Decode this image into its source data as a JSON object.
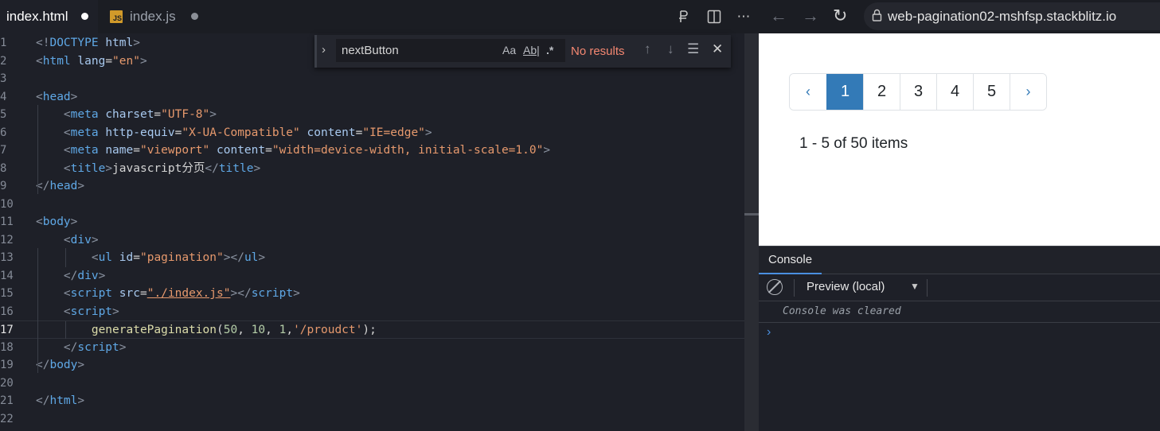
{
  "tabs": [
    {
      "label": "index.html",
      "modified": true,
      "active": true
    },
    {
      "label": "index.js",
      "icon": "JS",
      "modified": true,
      "active": false
    }
  ],
  "editor_lines": [
    {
      "n": "1",
      "tokens": [
        [
          "t-br",
          "<!"
        ],
        [
          "t-tag",
          "DOCTYPE"
        ],
        [
          "t-txt",
          " "
        ],
        [
          "t-attr",
          "html"
        ],
        [
          "t-br",
          ">"
        ]
      ]
    },
    {
      "n": "2",
      "tokens": [
        [
          "t-br",
          "<"
        ],
        [
          "t-tag",
          "html"
        ],
        [
          "t-txt",
          " "
        ],
        [
          "t-attr",
          "lang"
        ],
        [
          "t-txt",
          "="
        ],
        [
          "t-str",
          "\"en\""
        ],
        [
          "t-br",
          ">"
        ]
      ]
    },
    {
      "n": "3",
      "tokens": []
    },
    {
      "n": "4",
      "tokens": [
        [
          "t-br",
          "<"
        ],
        [
          "t-tag",
          "head"
        ],
        [
          "t-br",
          ">"
        ]
      ]
    },
    {
      "n": "5",
      "tokens": [
        [
          "t-txt",
          "    "
        ],
        [
          "t-br",
          "<"
        ],
        [
          "t-tag",
          "meta"
        ],
        [
          "t-txt",
          " "
        ],
        [
          "t-attr",
          "charset"
        ],
        [
          "t-txt",
          "="
        ],
        [
          "t-str",
          "\"UTF-8\""
        ],
        [
          "t-br",
          ">"
        ]
      ]
    },
    {
      "n": "6",
      "tokens": [
        [
          "t-txt",
          "    "
        ],
        [
          "t-br",
          "<"
        ],
        [
          "t-tag",
          "meta"
        ],
        [
          "t-txt",
          " "
        ],
        [
          "t-attr",
          "http-equiv"
        ],
        [
          "t-txt",
          "="
        ],
        [
          "t-str",
          "\"X-UA-Compatible\""
        ],
        [
          "t-txt",
          " "
        ],
        [
          "t-attr",
          "content"
        ],
        [
          "t-txt",
          "="
        ],
        [
          "t-str",
          "\"IE=edge\""
        ],
        [
          "t-br",
          ">"
        ]
      ]
    },
    {
      "n": "7",
      "tokens": [
        [
          "t-txt",
          "    "
        ],
        [
          "t-br",
          "<"
        ],
        [
          "t-tag",
          "meta"
        ],
        [
          "t-txt",
          " "
        ],
        [
          "t-attr",
          "name"
        ],
        [
          "t-txt",
          "="
        ],
        [
          "t-str",
          "\"viewport\""
        ],
        [
          "t-txt",
          " "
        ],
        [
          "t-attr",
          "content"
        ],
        [
          "t-txt",
          "="
        ],
        [
          "t-str",
          "\"width=device-width, initial-scale=1.0\""
        ],
        [
          "t-br",
          ">"
        ]
      ]
    },
    {
      "n": "8",
      "tokens": [
        [
          "t-txt",
          "    "
        ],
        [
          "t-br",
          "<"
        ],
        [
          "t-tag",
          "title"
        ],
        [
          "t-br",
          ">"
        ],
        [
          "t-txt",
          "javascript分页"
        ],
        [
          "t-br",
          "</"
        ],
        [
          "t-tag",
          "title"
        ],
        [
          "t-br",
          ">"
        ]
      ]
    },
    {
      "n": "9",
      "tokens": [
        [
          "t-br",
          "</"
        ],
        [
          "t-tag",
          "head"
        ],
        [
          "t-br",
          ">"
        ]
      ]
    },
    {
      "n": "10",
      "tokens": []
    },
    {
      "n": "11",
      "tokens": [
        [
          "t-br",
          "<"
        ],
        [
          "t-tag",
          "body"
        ],
        [
          "t-br",
          ">"
        ]
      ]
    },
    {
      "n": "12",
      "tokens": [
        [
          "t-txt",
          "    "
        ],
        [
          "t-br",
          "<"
        ],
        [
          "t-tag",
          "div"
        ],
        [
          "t-br",
          ">"
        ]
      ]
    },
    {
      "n": "13",
      "tokens": [
        [
          "t-txt",
          "        "
        ],
        [
          "t-br",
          "<"
        ],
        [
          "t-tag",
          "ul"
        ],
        [
          "t-txt",
          " "
        ],
        [
          "t-attr",
          "id"
        ],
        [
          "t-txt",
          "="
        ],
        [
          "t-str",
          "\"pagination\""
        ],
        [
          "t-br",
          "></"
        ],
        [
          "t-tag",
          "ul"
        ],
        [
          "t-br",
          ">"
        ]
      ]
    },
    {
      "n": "14",
      "tokens": [
        [
          "t-txt",
          "    "
        ],
        [
          "t-br",
          "</"
        ],
        [
          "t-tag",
          "div"
        ],
        [
          "t-br",
          ">"
        ]
      ]
    },
    {
      "n": "15",
      "tokens": [
        [
          "t-txt",
          "    "
        ],
        [
          "t-br",
          "<"
        ],
        [
          "t-tag",
          "script"
        ],
        [
          "t-txt",
          " "
        ],
        [
          "t-attr",
          "src"
        ],
        [
          "t-txt",
          "="
        ],
        [
          "t-str",
          "\"./index.js\""
        ],
        [
          "t-br",
          "></"
        ],
        [
          "t-tag",
          "script"
        ],
        [
          "t-br",
          ">"
        ]
      ]
    },
    {
      "n": "16",
      "tokens": [
        [
          "t-txt",
          "    "
        ],
        [
          "t-br",
          "<"
        ],
        [
          "t-tag",
          "script"
        ],
        [
          "t-br",
          ">"
        ]
      ]
    },
    {
      "n": "17",
      "active": true,
      "tokens": [
        [
          "t-txt",
          "        "
        ],
        [
          "t-fn",
          "generatePagination"
        ],
        [
          "t-txt",
          "("
        ],
        [
          "t-num",
          "50"
        ],
        [
          "t-txt",
          ", "
        ],
        [
          "t-num",
          "10"
        ],
        [
          "t-txt",
          ", "
        ],
        [
          "t-num",
          "1"
        ],
        [
          "t-txt",
          ","
        ],
        [
          "t-str",
          "'/proudct'"
        ],
        [
          "t-txt",
          ");"
        ]
      ]
    },
    {
      "n": "18",
      "tokens": [
        [
          "t-txt",
          "    "
        ],
        [
          "t-br",
          "</"
        ],
        [
          "t-tag",
          "script"
        ],
        [
          "t-br",
          ">"
        ]
      ]
    },
    {
      "n": "19",
      "tokens": [
        [
          "t-br",
          "</"
        ],
        [
          "t-tag",
          "body"
        ],
        [
          "t-br",
          ">"
        ]
      ]
    },
    {
      "n": "20",
      "tokens": []
    },
    {
      "n": "21",
      "tokens": [
        [
          "t-br",
          "</"
        ],
        [
          "t-tag",
          "html"
        ],
        [
          "t-br",
          ">"
        ]
      ]
    },
    {
      "n": "22",
      "tokens": []
    }
  ],
  "find_widget": {
    "query": "nextButton",
    "match_case": "Aa",
    "whole_word": "Ab|",
    "regex": ".*",
    "status": "No results"
  },
  "browser": {
    "url": "web-pagination02-mshfsp.stackblitz.io"
  },
  "preview": {
    "pagination": [
      "‹",
      "1",
      "2",
      "3",
      "4",
      "5",
      "›"
    ],
    "active_page": "1",
    "summary": "1 - 5 of 50 items"
  },
  "console": {
    "tab": "Console",
    "context": "Preview (local)",
    "message": "Console was cleared",
    "prompt": "›"
  }
}
